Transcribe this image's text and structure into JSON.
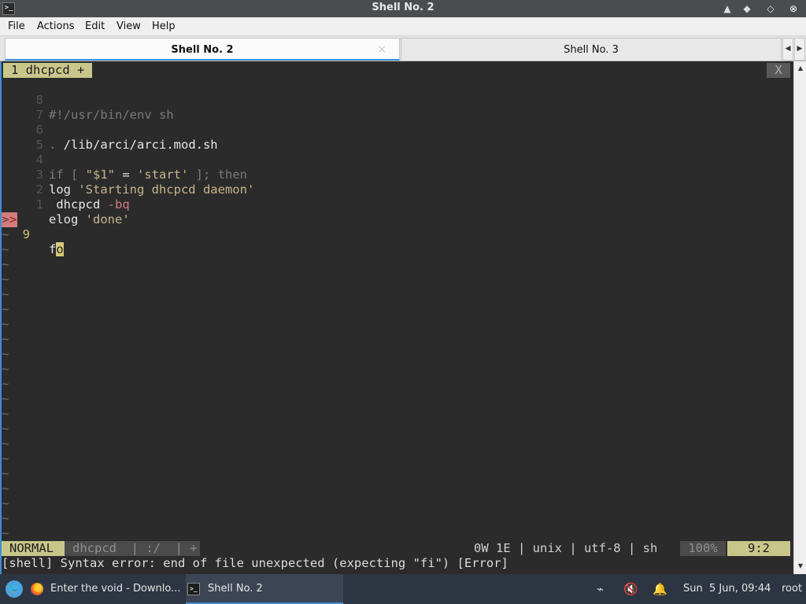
{
  "window": {
    "title": "Shell No. 2",
    "icon": "terminal-icon",
    "app_icon_glyph": ">_",
    "controls": {
      "minimize": "▲",
      "restore": "◆",
      "maximize": "◇",
      "close": "⊗"
    }
  },
  "menu": [
    "File",
    "Actions",
    "Edit",
    "View",
    "Help"
  ],
  "tabs": [
    {
      "label": "Shell No. 2",
      "active": true,
      "close": "×"
    },
    {
      "label": "Shell No. 3",
      "active": false
    }
  ],
  "tab_scroll": {
    "left": "◀",
    "right": "▶"
  },
  "vim": {
    "buffer_tab": "1 dhcpcd +",
    "buffer_close": "X",
    "lines": [
      {
        "num": "8",
        "text": "#!/usr/bin/env sh"
      },
      {
        "num": "7",
        "text": ""
      },
      {
        "num": "6",
        "text": ". /lib/arci/arci.mod.sh"
      },
      {
        "num": "5",
        "text": ""
      },
      {
        "num": "4",
        "text": "if [ \"$1\" = 'start' ]; then"
      },
      {
        "num": "3",
        "text": "log 'Starting dhcpcd daemon'"
      },
      {
        "num": "2",
        "text": " dhcpcd -bq"
      },
      {
        "num": "1",
        "text": "elog 'done'"
      },
      {
        "num": "9",
        "text": "fo",
        "sign": ">>"
      }
    ],
    "tilde": "~",
    "tilde_count": 22,
    "status": {
      "mode": "NORMAL",
      "file": "dhcpcd  | :/  | +",
      "info": "0W 1E | unix | utf-8 | sh",
      "percent": "100%",
      "position": "9:2"
    },
    "message": "[shell] Syntax error: end of file unexpected (expecting \"fi\") [Error]"
  },
  "scrollbar": {
    "up": "▲",
    "down": "▼"
  },
  "taskbar": {
    "start_icon": "void-logo-icon",
    "start_glyph": "🐦",
    "tasks": [
      {
        "label": "Enter the void - Downlo...",
        "icon": "firefox-icon"
      },
      {
        "label": "Shell No. 2",
        "icon": "terminal-icon",
        "glyph": ">_"
      }
    ],
    "tray": {
      "network": "⌁",
      "volume": "🔇",
      "notifications": "🔔"
    },
    "clock": "Sun  5 Jun, 09:44",
    "user": "root"
  }
}
